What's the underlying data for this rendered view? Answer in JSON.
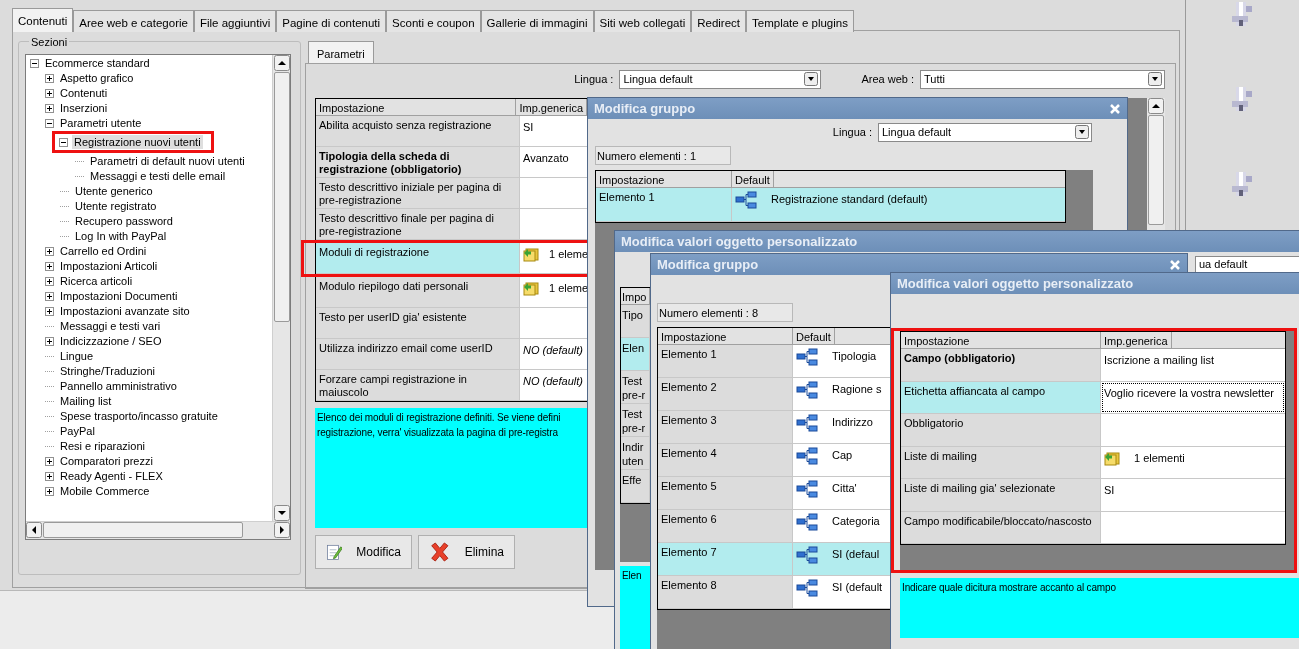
{
  "tabs": [
    {
      "label": "Contenuti",
      "selected": true
    },
    {
      "label": "Aree web e categorie",
      "selected": false
    },
    {
      "label": "File aggiuntivi",
      "selected": false
    },
    {
      "label": "Pagine di contenuti",
      "selected": false
    },
    {
      "label": "Sconti e coupon",
      "selected": false
    },
    {
      "label": "Gallerie di immagini",
      "selected": false
    },
    {
      "label": "Siti web collegati",
      "selected": false
    },
    {
      "label": "Redirect",
      "selected": false
    },
    {
      "label": "Template e plugins",
      "selected": false
    }
  ],
  "sidebar": {
    "title": "Sezioni",
    "tree": [
      {
        "label": "Ecommerce standard",
        "expanded": true,
        "selected": false,
        "children": [
          {
            "label": "Aspetto grafico",
            "expanded": false,
            "selected": false
          },
          {
            "label": "Contenuti",
            "expanded": false,
            "selected": false
          },
          {
            "label": "Inserzioni",
            "expanded": false,
            "selected": false
          },
          {
            "label": "Parametri utente",
            "expanded": true,
            "selected": false,
            "children": [
              {
                "label": "Registrazione nuovi utenti",
                "expanded": true,
                "selected": true,
                "marked": true,
                "children": [
                  {
                    "label": "Parametri di default nuovi utenti",
                    "selected": false
                  },
                  {
                    "label": "Messaggi e testi delle email",
                    "selected": false
                  }
                ]
              },
              {
                "label": "Utente generico",
                "selected": false
              },
              {
                "label": "Utente registrato",
                "selected": false
              },
              {
                "label": "Recupero password",
                "selected": false
              },
              {
                "label": "Log In with PayPal",
                "selected": false
              }
            ]
          },
          {
            "label": "Carrello ed Ordini",
            "expanded": false,
            "selected": false
          },
          {
            "label": "Impostazioni Articoli",
            "expanded": false,
            "selected": false
          },
          {
            "label": "Ricerca articoli",
            "expanded": false,
            "selected": false
          },
          {
            "label": "Impostazioni Documenti",
            "expanded": false,
            "selected": false
          },
          {
            "label": "Impostazioni avanzate sito",
            "expanded": false,
            "selected": false
          },
          {
            "label": "Messaggi e testi vari",
            "selected": false
          },
          {
            "label": "Indicizzazione / SEO",
            "expanded": false,
            "selected": false
          },
          {
            "label": "Lingue",
            "selected": false
          },
          {
            "label": "Stringhe/Traduzioni",
            "selected": false
          },
          {
            "label": "Pannello amministrativo",
            "selected": false
          },
          {
            "label": "Mailing list",
            "selected": false
          },
          {
            "label": "Spese trasporto/incasso gratuite",
            "selected": false
          },
          {
            "label": "PayPal",
            "selected": false
          },
          {
            "label": "Resi e riparazioni",
            "selected": false
          },
          {
            "label": "Comparatori prezzi",
            "expanded": false,
            "selected": false
          },
          {
            "label": "Ready Agenti - FLEX",
            "expanded": false,
            "selected": false
          },
          {
            "label": "Mobile Commerce",
            "expanded": false,
            "selected": false
          }
        ]
      }
    ]
  },
  "panel": {
    "tab": {
      "label": "Parametri",
      "selected": true
    },
    "filters": [
      {
        "label": "Lingua :",
        "value": "Lingua default"
      },
      {
        "label": "Area web :",
        "value": "Tutti"
      }
    ],
    "table": {
      "columns": [
        "Impostazione",
        "Imp.generica"
      ],
      "rows": [
        {
          "label": "Abilita acquisto senza registrazione",
          "value": "SI",
          "default_value": false,
          "selected": false
        },
        {
          "label": "Tipologia della scheda di registrazione (obbligatorio)",
          "required": true,
          "value": "Avanzato",
          "default_value": false,
          "selected": false
        },
        {
          "label": "Testo descrittivo iniziale per pagina di pre-registrazione",
          "selected": false
        },
        {
          "label": "Testo descrittivo finale per pagina di pre-registrazione",
          "selected": false
        },
        {
          "label": "Moduli di registrazione",
          "kind": "list",
          "value": "1 eleme",
          "default_value": false,
          "selected": true,
          "marked": true
        },
        {
          "label": "Modulo riepilogo dati personali",
          "kind": "list",
          "value": "1 eleme",
          "default_value": false,
          "selected": false
        },
        {
          "label": "Testo per userID gia' esistente",
          "selected": false
        },
        {
          "label": "Utilizza indirizzo email come userID",
          "value": "NO (default)",
          "default_value": true,
          "selected": false
        },
        {
          "label": "Forzare campi registrazione in maiuscolo",
          "value": "NO (default)",
          "default_value": true,
          "selected": false
        }
      ]
    },
    "description": [
      "Elenco dei moduli di registrazione definiti. Se viene defini",
      "registrazione, verra' visualizzata la pagina di pre-registra"
    ],
    "buttons": [
      {
        "label": "Modifica",
        "kind": "edit"
      },
      {
        "label": "Elimina",
        "kind": "delete"
      }
    ]
  },
  "dialogs": [
    {
      "title": "Modifica gruppo",
      "closable": true,
      "filter": {
        "label": "Lingua :",
        "value": "Lingua default"
      },
      "count": "Numero elementi : 1",
      "table": {
        "columns": [
          "Impostazione",
          "Default"
        ],
        "rows": [
          {
            "label": "Elemento 1",
            "kind": "object",
            "value": "Registrazione standard (default)",
            "selected": true
          }
        ]
      }
    },
    {
      "title": "Modifica valori oggetto personalizzato",
      "closable": false,
      "filter": {
        "value": "ua default"
      },
      "table": {
        "columns": [
          "Impo"
        ],
        "rows": [
          {
            "label": "Tipo",
            "selected": false
          },
          {
            "label": "Elen",
            "selected": true
          },
          {
            "label": "Test pre-r",
            "selected": false
          },
          {
            "label": "Test pre-r",
            "selected": false
          },
          {
            "label": "Indir uten",
            "selected": false
          },
          {
            "label": "Effe",
            "selected": false
          }
        ]
      },
      "description": "Elen"
    },
    {
      "title": "Modifica gruppo",
      "closable": true,
      "count": "Numero elementi : 8",
      "table": {
        "columns": [
          "Impostazione",
          "Default"
        ],
        "rows": [
          {
            "label": "Elemento 1",
            "kind": "object",
            "value": "Tipologia",
            "selected": false
          },
          {
            "label": "Elemento 2",
            "kind": "object",
            "value": "Ragione s",
            "selected": false
          },
          {
            "label": "Elemento 3",
            "kind": "object",
            "value": "Indirizzo",
            "selected": false
          },
          {
            "label": "Elemento 4",
            "kind": "object",
            "value": "Cap",
            "selected": false
          },
          {
            "label": "Elemento 5",
            "kind": "object",
            "value": "Citta'",
            "selected": false
          },
          {
            "label": "Elemento 6",
            "kind": "object",
            "value": "Categoria",
            "selected": false
          },
          {
            "label": "Elemento 7",
            "kind": "object",
            "value": "SI (defaul",
            "selected": true
          },
          {
            "label": "Elemento 8",
            "kind": "object",
            "value": "SI (default",
            "selected": false
          }
        ]
      }
    },
    {
      "title": "Modifica valori oggetto personalizzato",
      "closable": false,
      "marked": true,
      "table": {
        "columns": [
          "Impostazione",
          "Imp.generica"
        ],
        "rows": [
          {
            "label": "Campo (obbligatorio)",
            "required": true,
            "value": "Iscrizione a mailing list",
            "selected": false,
            "focused": false
          },
          {
            "label": "Etichetta affiancata al campo",
            "value": "Voglio ricevere la vostra newsletter",
            "selected": true,
            "focused": true
          },
          {
            "label": "Obbligatorio",
            "selected": false,
            "focused": false
          },
          {
            "label": "Liste di mailing",
            "kind": "list",
            "value": "1 elementi",
            "selected": false,
            "focused": false
          },
          {
            "label": "Liste di mailing gia' selezionate",
            "value": "SI",
            "selected": false,
            "focused": false
          },
          {
            "label": "Campo modificabile/bloccato/nascosto",
            "selected": false,
            "focused": false
          }
        ]
      },
      "description": "Indicare quale dicitura mostrare accanto al campo"
    }
  ]
}
